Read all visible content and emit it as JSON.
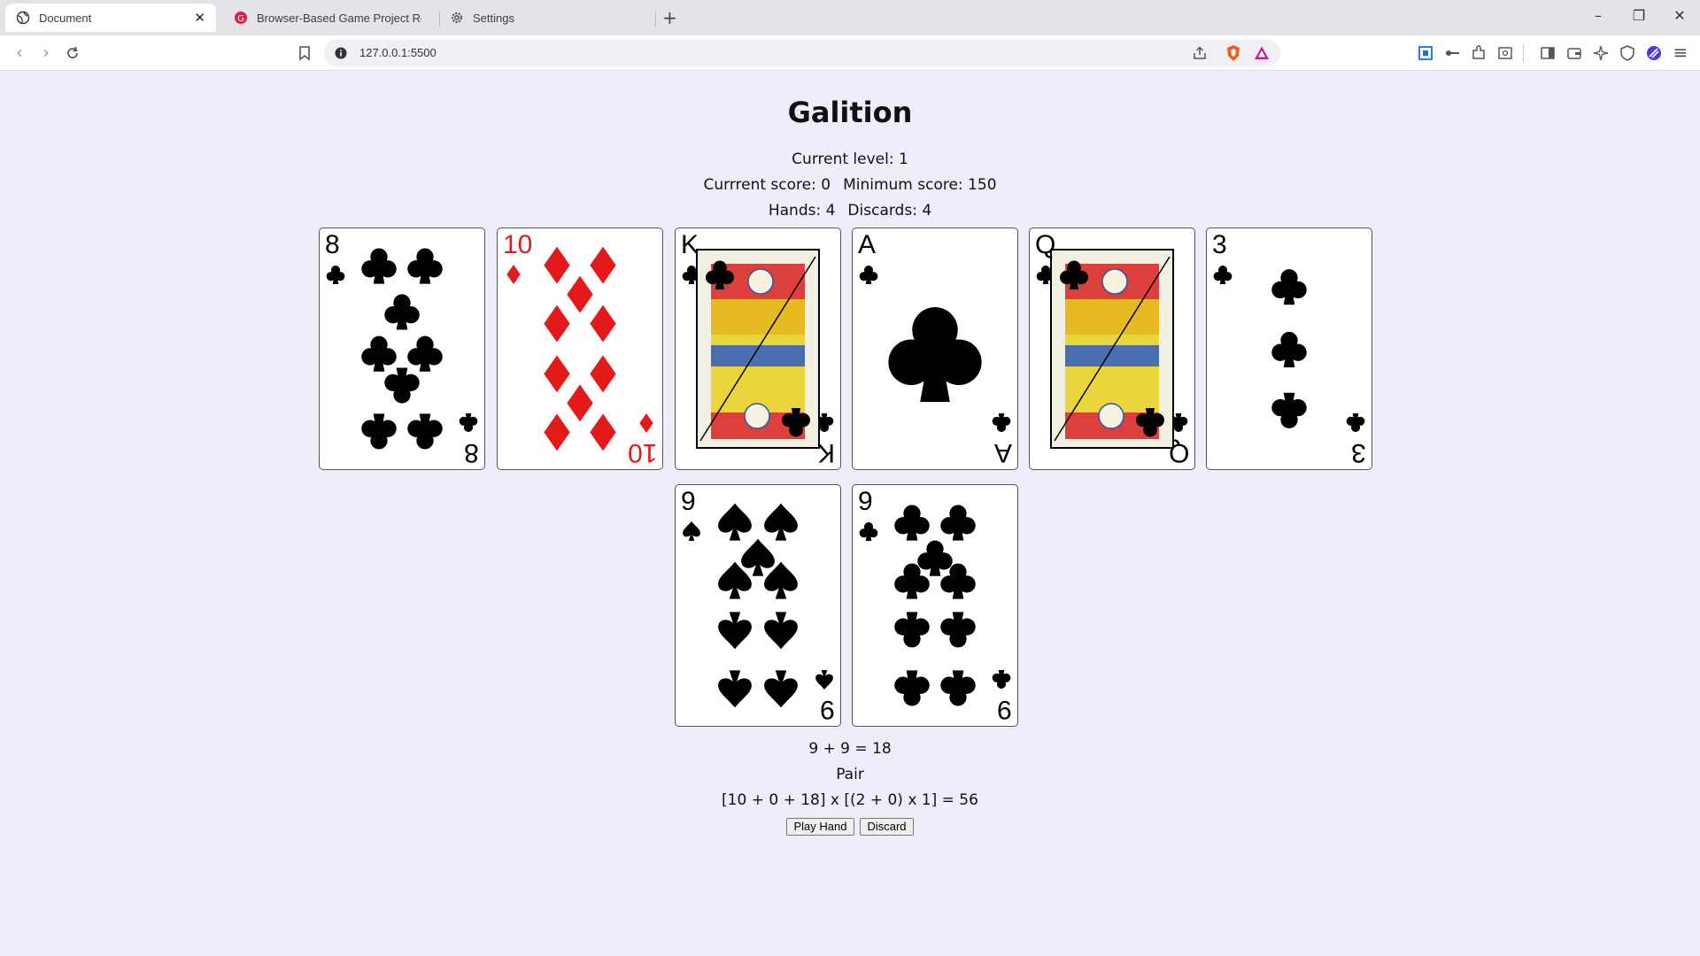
{
  "browser": {
    "tabs": [
      {
        "title": "Document",
        "active": true
      },
      {
        "title": "Browser-Based Game Project Require",
        "active": false
      },
      {
        "title": "Settings",
        "active": false
      }
    ],
    "url": "127.0.0.1:5500"
  },
  "game": {
    "title": "Galition",
    "level_label": "Current level: 1",
    "score_label": "Currrent score: 0",
    "min_score_label": "Minimum score: 150",
    "hands_label": "Hands: 4",
    "discards_label": "Discards: 4",
    "cards": [
      {
        "rank": "8",
        "suit": "clubs",
        "color": "black"
      },
      {
        "rank": "10",
        "suit": "diamonds",
        "color": "red"
      },
      {
        "rank": "K",
        "suit": "clubs",
        "color": "black"
      },
      {
        "rank": "A",
        "suit": "clubs",
        "color": "black"
      },
      {
        "rank": "Q",
        "suit": "clubs",
        "color": "black"
      },
      {
        "rank": "3",
        "suit": "clubs",
        "color": "black"
      },
      {
        "rank": "9",
        "suit": "spades",
        "color": "black"
      },
      {
        "rank": "9",
        "suit": "clubs",
        "color": "black"
      }
    ],
    "sum_text": "9 + 9 = 18",
    "hand_type": "Pair",
    "formula": "[10 + 0 + 18] x [(2 + 0) x 1] = 56",
    "play_button": "Play Hand",
    "discard_button": "Discard"
  },
  "colors": {
    "page_background": "#eeeefb",
    "red_suit": "#e41a1a",
    "black_suit": "#000000"
  }
}
